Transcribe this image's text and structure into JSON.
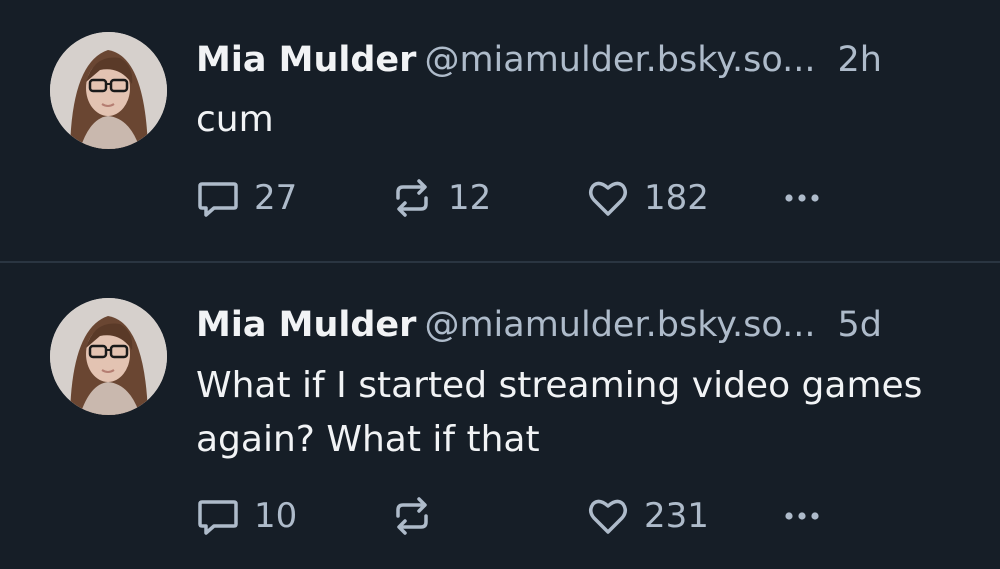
{
  "colors": {
    "background": "#161e27",
    "divider": "#2a3541",
    "primary_text": "#f1f3f5",
    "secondary_text": "#aebbca"
  },
  "posts": [
    {
      "author_name": "Mia Mulder",
      "handle": "@miamulder.bsky.so...",
      "time": "2h",
      "text": "cum",
      "reply_count": "27",
      "repost_count": "12",
      "like_count": "182",
      "icons": [
        "reply-icon",
        "repost-icon",
        "like-icon",
        "more-icon"
      ]
    },
    {
      "author_name": "Mia Mulder",
      "handle": "@miamulder.bsky.so...",
      "time": "5d",
      "text": "What if I started streaming video games again? What if that",
      "reply_count": "10",
      "repost_count": "",
      "like_count": "231",
      "icons": [
        "reply-icon",
        "repost-icon",
        "like-icon",
        "more-icon"
      ]
    }
  ]
}
